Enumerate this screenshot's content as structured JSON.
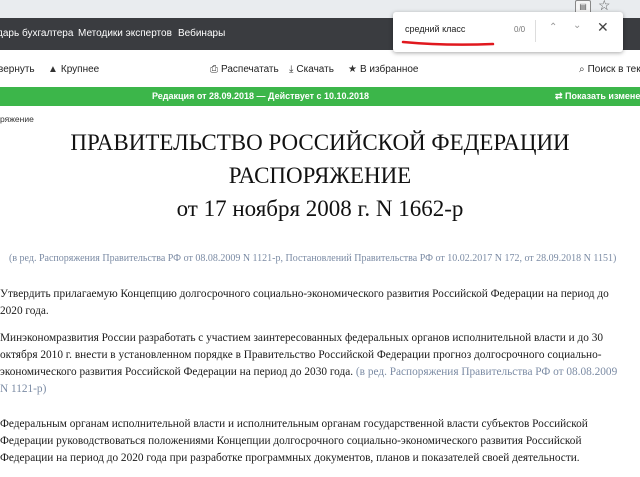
{
  "nav": {
    "links": [
      "дарь бухгалтера",
      "Методики экспертов",
      "Вебинары"
    ]
  },
  "find_bar": {
    "query": "средний класс",
    "count": "0/0",
    "underline_color": "#e0181e"
  },
  "toolbar": {
    "collapse": "вернуть",
    "zoom": "Крупнее",
    "print": "Распечатать",
    "download": "Скачать",
    "favorites": "В избранное",
    "search": "Поиск в тек"
  },
  "edition_bar": {
    "text": "Редакция от 28.09.2018 — Действует с 10.10.2018",
    "show_changes": "Показать измене",
    "color": "#3cb64a"
  },
  "breadcrumb": "ряжение",
  "document": {
    "title_lines": [
      "ПРАВИТЕЛЬСТВО РОССИЙСКОЙ ФЕДЕРАЦИИ",
      "РАСПОРЯЖЕНИЕ",
      "от 17 ноября 2008 г. N 1662-р"
    ],
    "edition_note": "(в ред. Распоряжения Правительства РФ   от 08.08.2009 N 1121-р, Постановлений Правительства РФ   от 10.02.2017 N 172,   от 28.09.2018 N 1151)",
    "p1": [
      "Утвердить прилагаемую Концепцию долгосрочного социально-экономического развития Российской Федерации на период до",
      "2020 года."
    ],
    "p2": [
      "Минэкономразвития России разработать с участием заинтересованных федеральных органов исполнительной власти и до 30",
      "октября 2010 г. внести в установленном порядке в Правительство Российской Федерации прогноз долгосрочного социально-",
      "экономического развития Российской Федерации на период до 2030 года.",
      " (в ред. Распоряжения Правительства РФ от 08.08.2009",
      "N 1121-р)"
    ],
    "p3": [
      "Федеральным органам исполнительной власти и исполнительным органам государственной власти субъектов Российской",
      "Федерации руководствоваться положениями Концепции долгосрочного социально-экономического развития Российской",
      "Федерации на период до 2020 года при разработке программных документов, планов и показателей своей деятельности."
    ]
  }
}
